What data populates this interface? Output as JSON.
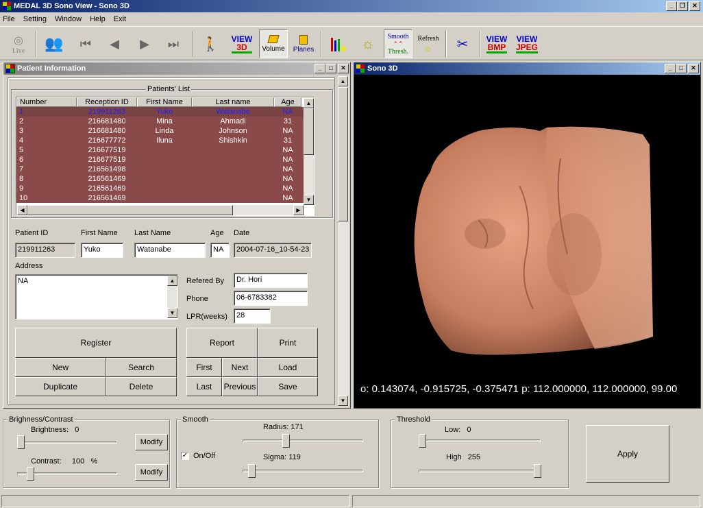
{
  "window": {
    "title": "MEDAL 3D Sono View - Sono 3D"
  },
  "menu": [
    "File",
    "Setting",
    "Window",
    "Help",
    "Exit"
  ],
  "toolbar": {
    "live": "Live",
    "view3d_a": "VIEW",
    "view3d_b": "3D",
    "volume": "Volume",
    "planes": "Planes",
    "smooth": "Smooth",
    "thresh": "Thresh.",
    "refresh": "Refresh",
    "viewbmp_a": "VIEW",
    "viewbmp_b": "BMP",
    "viewjpeg_a": "VIEW",
    "viewjpeg_b": "JPEG"
  },
  "patient_panel": {
    "title": "Patient Information",
    "list_title": "Patients' List",
    "columns": [
      "Number",
      "Reception ID",
      "First Name",
      "Last name",
      "Age"
    ],
    "rows": [
      [
        "1",
        "219911263",
        "Yuko",
        "Watanabe",
        "NA"
      ],
      [
        "2",
        "216681480",
        "Mina",
        "Ahmadi",
        "31"
      ],
      [
        "3",
        "216681480",
        "Linda",
        "Johnson",
        "NA"
      ],
      [
        "4",
        "216677772",
        "Iluna",
        "Shishkin",
        "31"
      ],
      [
        "5",
        "216677519",
        "",
        "",
        "NA"
      ],
      [
        "6",
        "216677519",
        "",
        "",
        "NA"
      ],
      [
        "7",
        "216561498",
        "",
        "",
        "NA"
      ],
      [
        "8",
        "216561469",
        "",
        "",
        "NA"
      ],
      [
        "9",
        "216561469",
        "",
        "",
        "NA"
      ],
      [
        "10",
        "216561469",
        "",
        "",
        "NA"
      ]
    ],
    "labels": {
      "patient_id": "Patient ID",
      "first_name": "First Name",
      "last_name": "Last Name",
      "age": "Age",
      "date": "Date",
      "address": "Address",
      "refered_by": "Refered By",
      "phone": "Phone",
      "lpr": "LPR(weeks)"
    },
    "values": {
      "patient_id": "219911263",
      "first_name": "Yuko",
      "last_name": "Watanabe",
      "age": "NA",
      "date": "2004-07-16_10-54-23",
      "address": "NA",
      "refered_by": "Dr. Hori",
      "phone": "06-6783382",
      "lpr": "28"
    },
    "buttons": {
      "register": "Register",
      "new": "New",
      "search": "Search",
      "duplicate": "Duplicate",
      "delete": "Delete",
      "report": "Report",
      "print": "Print",
      "first": "First",
      "next": "Next",
      "load": "Load",
      "last": "Last",
      "previous": "Previous",
      "save": "Save"
    }
  },
  "sono_panel": {
    "title": "Sono 3D",
    "readout": "o: 0.143074, -0.915725, -0.375471  p: 112.000000, 112.000000, 99.00"
  },
  "bc": {
    "title": "Brighness/Contrast",
    "brightness_label": "Brightness:",
    "brightness_value": "0",
    "contrast_label": "Contrast:",
    "contrast_value": "100",
    "contrast_unit": "%",
    "modify": "Modify",
    "brightness_pos": 0.0,
    "contrast_pos": 0.1
  },
  "smooth": {
    "title": "Smooth",
    "radius_label": "Radius:",
    "radius_value": "171",
    "sigma_label": "Sigma:",
    "sigma_value": "119",
    "onoff": "On/Off",
    "checked": true
  },
  "threshold": {
    "title": "Threshold",
    "low_label": "Low:",
    "low_value": "0",
    "high_label": "High",
    "high_value": "255"
  },
  "apply": "Apply"
}
